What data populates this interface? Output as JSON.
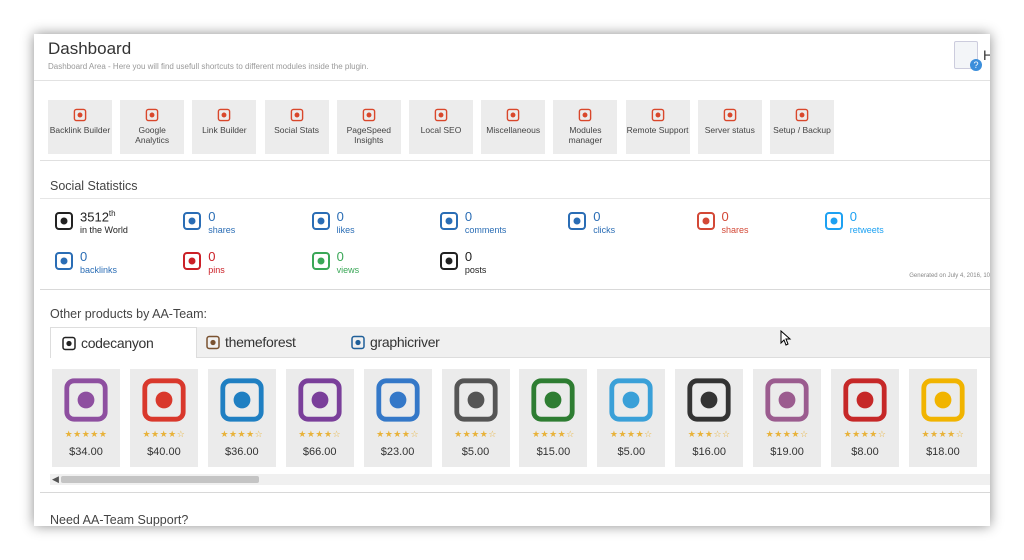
{
  "header": {
    "title": "Dashboard",
    "subtitle": "Dashboard Area - Here you will find usefull shortcuts to different modules inside the plugin.",
    "help_label": "H"
  },
  "shortcuts": [
    {
      "label": "Backlink Builder",
      "icon": "link-icon"
    },
    {
      "label": "Google Analytics",
      "icon": "analytics-icon"
    },
    {
      "label": "Link Builder",
      "icon": "link-builder-icon"
    },
    {
      "label": "Social Stats",
      "icon": "people-icon"
    },
    {
      "label": "PageSpeed Insights",
      "icon": "speedometer-icon"
    },
    {
      "label": "Local SEO",
      "icon": "globe-icon"
    },
    {
      "label": "Miscellaneous",
      "icon": "misc-icon"
    },
    {
      "label": "Modules manager",
      "icon": "plug-icon"
    },
    {
      "label": "Remote Support",
      "icon": "lifebuoy-icon"
    },
    {
      "label": "Server status",
      "icon": "battery-icon"
    },
    {
      "label": "Setup / Backup",
      "icon": "database-icon"
    }
  ],
  "social": {
    "title": "Social Statistics",
    "row1": [
      {
        "value": "3512",
        "sup": "th",
        "caption": "in the World",
        "icon": "alexa-icon",
        "color": "#222222"
      },
      {
        "value": "0",
        "caption": "shares",
        "icon": "facebook-icon",
        "color": "#2a6db5"
      },
      {
        "value": "0",
        "caption": "likes",
        "icon": "thumbs-up-icon",
        "color": "#2a6db5"
      },
      {
        "value": "0",
        "caption": "comments",
        "icon": "facebook-comments-icon",
        "color": "#2a6db5"
      },
      {
        "value": "0",
        "caption": "clicks",
        "icon": "facebook-icon",
        "color": "#2a6db5"
      },
      {
        "value": "0",
        "caption": "shares",
        "icon": "google-plus-icon",
        "color": "#d34836"
      },
      {
        "value": "0",
        "caption": "retweets",
        "icon": "twitter-icon",
        "color": "#1da1f2"
      }
    ],
    "row2": [
      {
        "value": "0",
        "caption": "backlinks",
        "icon": "linkedin-icon",
        "color": "#2a6db5"
      },
      {
        "value": "0",
        "caption": "pins",
        "icon": "pinterest-icon",
        "color": "#cb2027"
      },
      {
        "value": "0",
        "caption": "views",
        "icon": "stumbleupon-icon",
        "color": "#3aa757"
      },
      {
        "value": "0",
        "caption": "posts",
        "icon": "delicious-icon",
        "color": "#222222"
      }
    ],
    "generated": "Generated on July 4, 2016, 10"
  },
  "products": {
    "title": "Other products by AA-Team:",
    "tabs": [
      {
        "label": "codecanyon",
        "icon": "codecanyon-icon"
      },
      {
        "label": "themeforest",
        "icon": "themeforest-icon"
      },
      {
        "label": "graphicriver",
        "icon": "graphicriver-icon"
      }
    ],
    "items": [
      {
        "price": "$34.00",
        "rating": 5,
        "icon": "woozone-icon",
        "color": "#8e4fa0"
      },
      {
        "price": "$40.00",
        "rating": 4,
        "icon": "premium-seo-pack-icon",
        "color": "#d9382c"
      },
      {
        "price": "$36.00",
        "rating": 4,
        "icon": "amazon-estore-icon",
        "color": "#1f7fc2"
      },
      {
        "price": "$66.00",
        "rating": 4,
        "icon": "gift-box-icon",
        "color": "#7a3f9a"
      },
      {
        "price": "$23.00",
        "rating": 4,
        "icon": "seo-wordpress-icon",
        "color": "#3478c8"
      },
      {
        "price": "$5.00",
        "rating": 4,
        "icon": "flip-clock-icon",
        "color": "#555555"
      },
      {
        "price": "$15.00",
        "rating": 4,
        "icon": "video-widget-icon",
        "color": "#2e7d32"
      },
      {
        "price": "$5.00",
        "rating": 4,
        "icon": "slider-app-icon",
        "color": "#3aa0d8"
      },
      {
        "price": "$16.00",
        "rating": 3,
        "icon": "premium-watermark-icon",
        "color": "#333333"
      },
      {
        "price": "$19.00",
        "rating": 4,
        "icon": "woocommerce-color-filter-icon",
        "color": "#9b5c8f"
      },
      {
        "price": "$8.00",
        "rating": 4,
        "icon": "christmas-magic-icon",
        "color": "#c62828"
      },
      {
        "price": "$18.00",
        "rating": 4,
        "icon": "stopwatch-icon",
        "color": "#f1b400"
      }
    ]
  },
  "support": {
    "title": "Need AA-Team Support?"
  },
  "scroll": {
    "left_arrow": "◀"
  }
}
